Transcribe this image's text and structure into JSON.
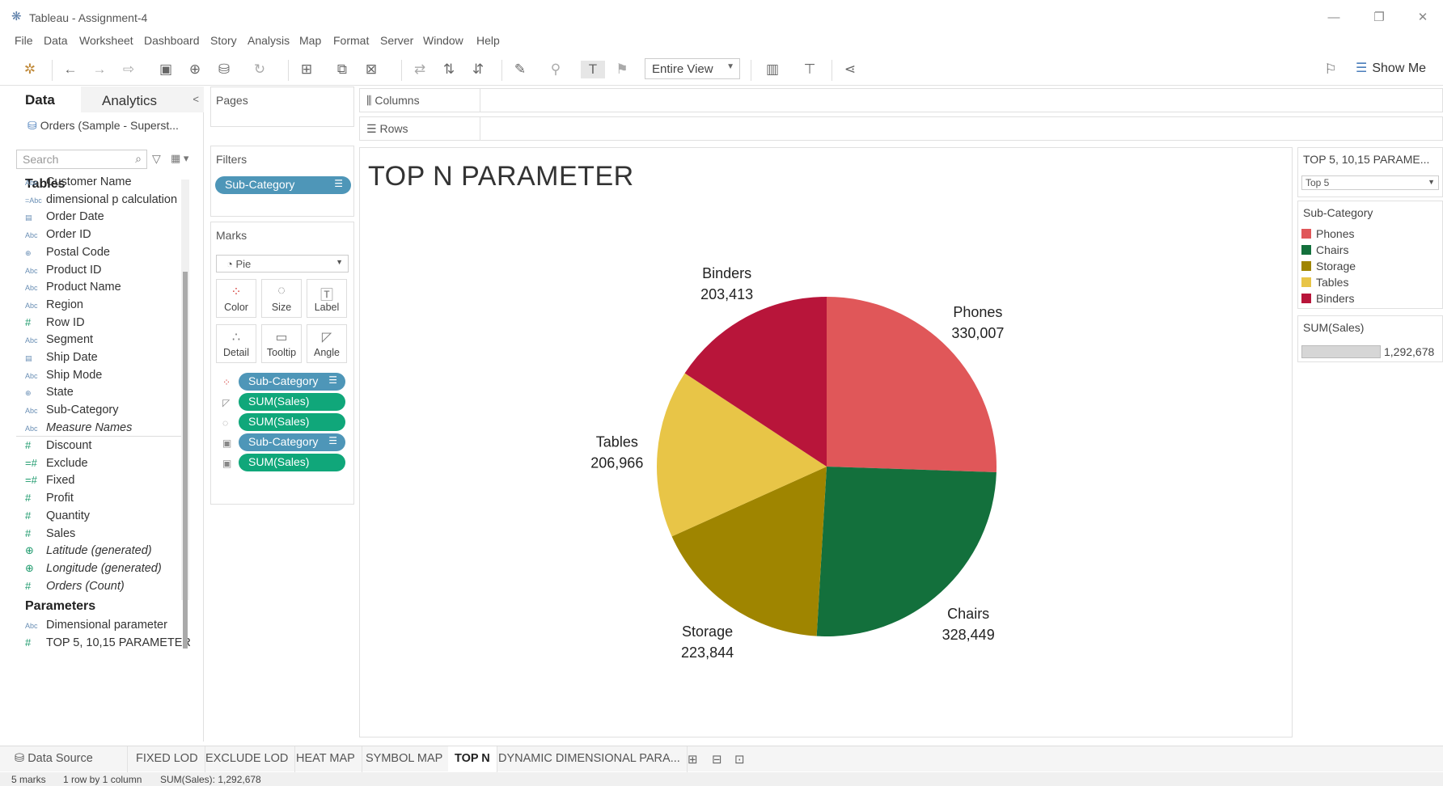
{
  "window": {
    "title": "Tableau - Assignment-4"
  },
  "menu": [
    "File",
    "Data",
    "Worksheet",
    "Dashboard",
    "Story",
    "Analysis",
    "Map",
    "Format",
    "Server",
    "Window",
    "Help"
  ],
  "toolbar": {
    "view_select": "Entire View",
    "show_me": "Show Me"
  },
  "data_pane": {
    "tab_data": "Data",
    "tab_analytics": "Analytics",
    "datasource": "Orders (Sample - Superst...",
    "search_placeholder": "Search",
    "tables_header": "Tables",
    "dimensions": [
      {
        "type": "Abc",
        "name": "Customer Name"
      },
      {
        "type": "=Abc",
        "name": "dimensional p calculation"
      },
      {
        "type": "date",
        "name": "Order Date"
      },
      {
        "type": "Abc",
        "name": "Order ID"
      },
      {
        "type": "geo",
        "name": "Postal Code"
      },
      {
        "type": "Abc",
        "name": "Product ID"
      },
      {
        "type": "Abc",
        "name": "Product Name"
      },
      {
        "type": "Abc",
        "name": "Region"
      },
      {
        "type": "#",
        "name": "Row ID"
      },
      {
        "type": "Abc",
        "name": "Segment"
      },
      {
        "type": "date",
        "name": "Ship Date"
      },
      {
        "type": "Abc",
        "name": "Ship Mode"
      },
      {
        "type": "geo",
        "name": "State"
      },
      {
        "type": "Abc",
        "name": "Sub-Category"
      },
      {
        "type": "Abc",
        "name": "Measure Names",
        "italic": true
      }
    ],
    "measures": [
      {
        "type": "#",
        "name": "Discount"
      },
      {
        "type": "=#",
        "name": "Exclude"
      },
      {
        "type": "=#",
        "name": "Fixed"
      },
      {
        "type": "#",
        "name": "Profit"
      },
      {
        "type": "#",
        "name": "Quantity"
      },
      {
        "type": "#",
        "name": "Sales"
      },
      {
        "type": "geo",
        "name": "Latitude (generated)",
        "italic": true
      },
      {
        "type": "geo",
        "name": "Longitude (generated)",
        "italic": true
      },
      {
        "type": "#",
        "name": "Orders (Count)",
        "italic": true
      }
    ],
    "parameters_header": "Parameters",
    "parameters": [
      {
        "type": "Abc",
        "name": "Dimensional parameter"
      },
      {
        "type": "#",
        "name": "TOP 5, 10,15 PARAMETER"
      }
    ]
  },
  "shelves": {
    "pages": "Pages",
    "filters": "Filters",
    "filter_pill": "Sub-Category",
    "marks": "Marks",
    "mark_type": "Pie",
    "mark_buttons": [
      "Color",
      "Size",
      "Label",
      "Detail",
      "Tooltip",
      "Angle"
    ],
    "mark_pills": [
      {
        "kind": "dim",
        "icon": "color",
        "label": "Sub-Category",
        "sort": true
      },
      {
        "kind": "mea",
        "icon": "angle",
        "label": "SUM(Sales)"
      },
      {
        "kind": "mea",
        "icon": "size",
        "label": "SUM(Sales)"
      },
      {
        "kind": "dim",
        "icon": "label",
        "label": "Sub-Category",
        "sort": true
      },
      {
        "kind": "mea",
        "icon": "label",
        "label": "SUM(Sales)"
      }
    ],
    "columns": "Columns",
    "rows": "Rows"
  },
  "viz": {
    "title": "TOP N PARAMETER"
  },
  "chart_data": {
    "type": "pie",
    "title": "TOP N PARAMETER",
    "categories": [
      "Phones",
      "Chairs",
      "Storage",
      "Tables",
      "Binders"
    ],
    "values": [
      330007,
      328449,
      223844,
      206966,
      203413
    ],
    "value_labels": [
      "330,007",
      "328,449",
      "223,844",
      "206,966",
      "203,413"
    ],
    "colors": [
      "#e05759",
      "#13703c",
      "#9f8500",
      "#e8c547",
      "#b8153a"
    ],
    "legend_position": "right"
  },
  "legend": {
    "param_title": "TOP 5, 10,15 PARAME...",
    "param_value": "Top 5",
    "color_title": "Sub-Category",
    "size_title": "SUM(Sales)",
    "size_value": "1,292,678"
  },
  "sheet_tabs": {
    "data_source": "Data Source",
    "tabs": [
      "FIXED LOD",
      "EXCLUDE LOD",
      "HEAT MAP",
      "SYMBOL MAP",
      "TOP N",
      "DYNAMIC DIMENSIONAL PARA..."
    ],
    "active": "TOP N"
  },
  "status": {
    "marks": "5 marks",
    "rows_cols": "1 row by 1 column",
    "sum": "SUM(Sales): 1,292,678"
  }
}
